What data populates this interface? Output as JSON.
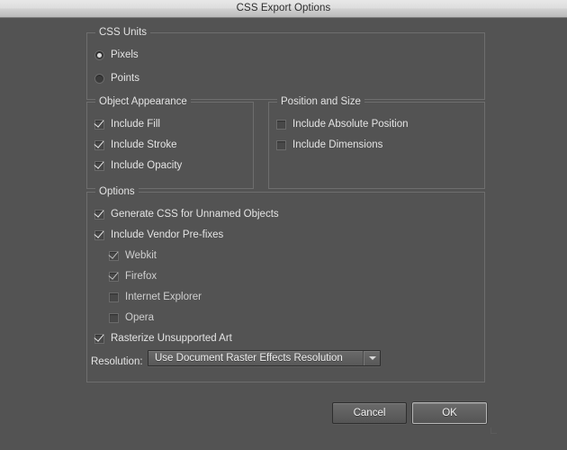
{
  "window": {
    "title": "CSS Export Options"
  },
  "groups": {
    "css_units": {
      "title": "CSS Units",
      "options": [
        {
          "label": "Pixels",
          "selected": true
        },
        {
          "label": "Points",
          "selected": false
        }
      ]
    },
    "object_appearance": {
      "title": "Object Appearance",
      "items": [
        {
          "label": "Include Fill",
          "checked": true
        },
        {
          "label": "Include Stroke",
          "checked": true
        },
        {
          "label": "Include Opacity",
          "checked": true
        }
      ]
    },
    "position_and_size": {
      "title": "Position and Size",
      "items": [
        {
          "label": "Include Absolute Position",
          "checked": false
        },
        {
          "label": "Include Dimensions",
          "checked": false
        }
      ]
    },
    "options": {
      "title": "Options",
      "items": [
        {
          "label": "Generate CSS for Unnamed Objects",
          "checked": true
        },
        {
          "label": "Include Vendor Pre-fixes",
          "checked": true
        },
        {
          "label": "Webkit",
          "checked": true
        },
        {
          "label": "Firefox",
          "checked": true
        },
        {
          "label": "Internet Explorer",
          "checked": false
        },
        {
          "label": "Opera",
          "checked": false
        },
        {
          "label": "Rasterize Unsupported Art",
          "checked": true
        }
      ],
      "resolution": {
        "label": "Resolution:",
        "value": "Use Document Raster Effects Resolution",
        "arrow_icon": "chevron-down-icon"
      }
    }
  },
  "footer": {
    "cancel_label": "Cancel",
    "ok_label": "OK"
  },
  "colors": {
    "dialog_background": "#535353",
    "titlebar_top": "#e8e8e8",
    "titlebar_bottom": "#b9b9b9",
    "text": "#e4e4e4",
    "group_border": "#6e6e6e",
    "default_button_border": "#b7b7b7"
  }
}
